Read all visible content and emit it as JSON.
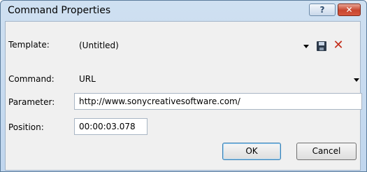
{
  "window": {
    "title": "Command Properties",
    "help_label": "?",
    "close_label": "✕"
  },
  "form": {
    "template_label": "Template:",
    "template_value": "(Untitled)",
    "command_label": "Command:",
    "command_value": "URL",
    "parameter_label": "Parameter:",
    "parameter_value": "http://www.sonycreativesoftware.com/",
    "position_label": "Position:",
    "position_value": "00:00:03.078"
  },
  "buttons": {
    "ok_label": "OK",
    "cancel_label": "Cancel"
  },
  "icons": {
    "save": "save-icon",
    "delete": "delete-icon"
  },
  "colors": {
    "title_bar": "#c5d9ef",
    "close_button": "#c8452e",
    "delete_icon": "#c32d1a"
  }
}
